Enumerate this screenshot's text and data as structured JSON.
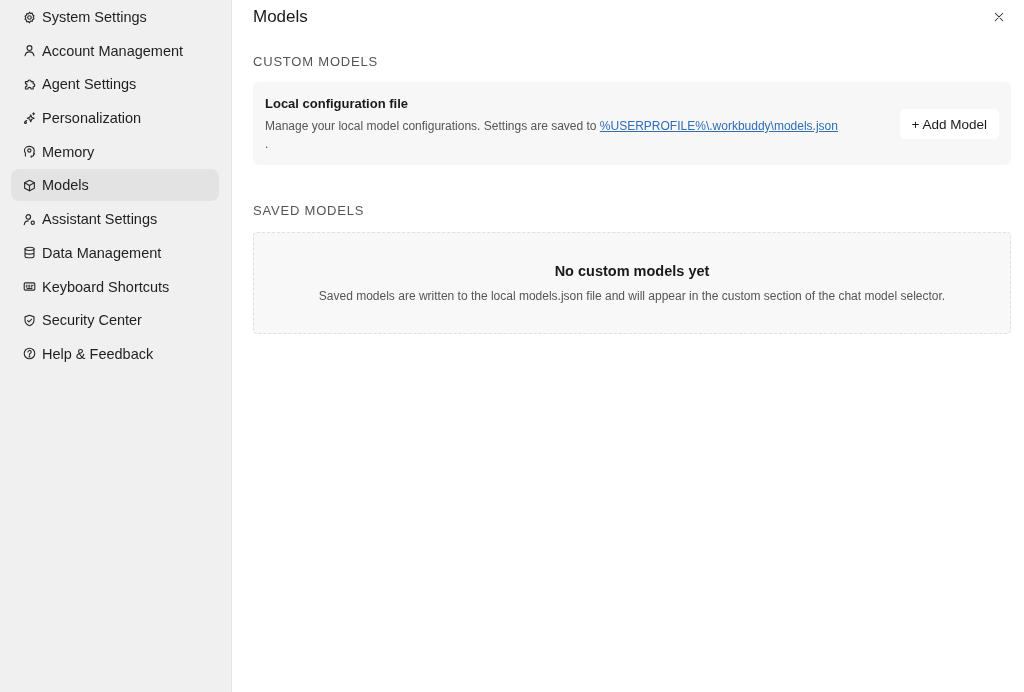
{
  "sidebar": {
    "items": [
      {
        "label": "System Settings",
        "selected": false
      },
      {
        "label": "Account Management",
        "selected": false
      },
      {
        "label": "Agent Settings",
        "selected": false
      },
      {
        "label": "Personalization",
        "selected": false
      },
      {
        "label": "Memory",
        "selected": false
      },
      {
        "label": "Models",
        "selected": true
      },
      {
        "label": "Assistant Settings",
        "selected": false
      },
      {
        "label": "Data Management",
        "selected": false
      },
      {
        "label": "Keyboard Shortcuts",
        "selected": false
      },
      {
        "label": "Security Center",
        "selected": false
      },
      {
        "label": "Help & Feedback",
        "selected": false
      }
    ]
  },
  "panel": {
    "title": "Models",
    "sections": [
      {
        "kind": "config",
        "heading": "CUSTOM MODELS",
        "card": {
          "title": "Local configuration file",
          "description": "Manage your local model configurations. Settings are saved to",
          "link": "%USERPROFILE%\\.workbuddy\\models.json",
          "trailing": ".",
          "button": "+ Add Model"
        }
      },
      {
        "kind": "empty",
        "heading": "SAVED MODELS",
        "empty_state": {
          "title": "No custom models yet",
          "description": "Saved models are written to the local models.json file and will appear in the custom section of the chat model selector."
        }
      }
    ]
  }
}
